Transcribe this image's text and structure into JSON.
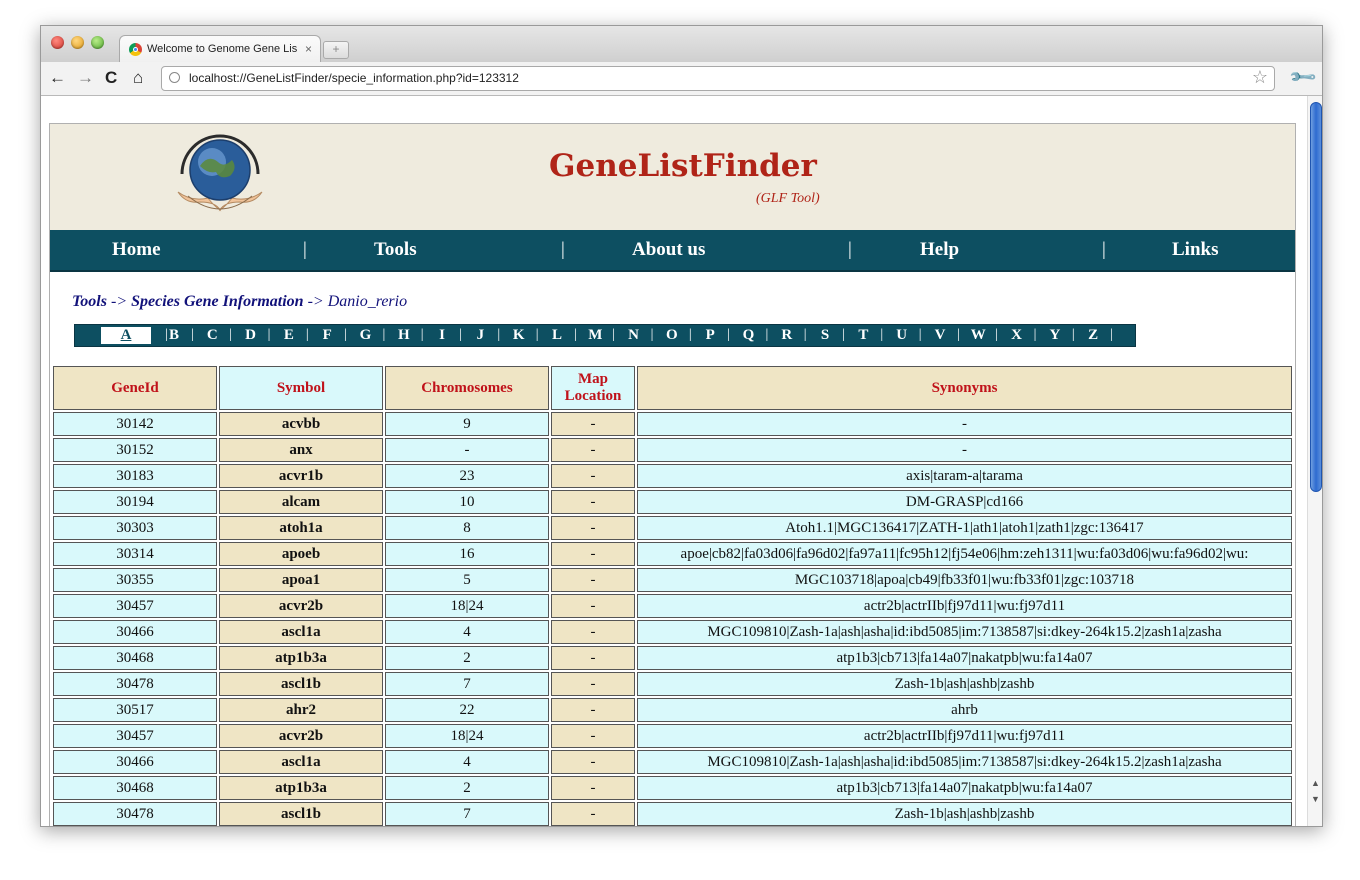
{
  "browser": {
    "tab_title": "Welcome to Genome Gene List Fi",
    "tab_close": "×",
    "new_tab": "+",
    "url": "localhost://GeneListFinder/specie_information.php?id=123312"
  },
  "header": {
    "title": "GeneListFinder",
    "subtitle": "(GLF Tool)"
  },
  "nav": {
    "items": [
      "Home",
      "Tools",
      "About us",
      "Help",
      "Links"
    ],
    "separator": "|"
  },
  "breadcrumb": {
    "part1": "Tools",
    "arrow": "->",
    "part2": "Species Gene Information",
    "part3": "Danio_rerio"
  },
  "alphabet": {
    "letters": [
      "A",
      "B",
      "C",
      "D",
      "E",
      "F",
      "G",
      "H",
      "I",
      "J",
      "K",
      "L",
      "M",
      "N",
      "O",
      "P",
      "Q",
      "R",
      "S",
      "T",
      "U",
      "V",
      "W",
      "X",
      "Y",
      "Z"
    ],
    "active": "A",
    "separator": "|"
  },
  "table": {
    "headers": [
      "GeneId",
      "Symbol",
      "Chromosomes",
      "Map Location",
      "Synonyms"
    ],
    "rows": [
      [
        "30142",
        "acvbb",
        "9",
        "-",
        "-"
      ],
      [
        "30152",
        "anx",
        "-",
        "-",
        "-"
      ],
      [
        "30183",
        "acvr1b",
        "23",
        "-",
        "axis|taram-a|tarama"
      ],
      [
        "30194",
        "alcam",
        "10",
        "-",
        "DM-GRASP|cd166"
      ],
      [
        "30303",
        "atoh1a",
        "8",
        "-",
        "Atoh1.1|MGC136417|ZATH-1|ath1|atoh1|zath1|zgc:136417"
      ],
      [
        "30314",
        "apoeb",
        "16",
        "-",
        "apoe|cb82|fa03d06|fa96d02|fa97a11|fc95h12|fj54e06|hm:zeh1311|wu:fa03d06|wu:fa96d02|wu:"
      ],
      [
        "30355",
        "apoa1",
        "5",
        "-",
        "MGC103718|apoa|cb49|fb33f01|wu:fb33f01|zgc:103718"
      ],
      [
        "30457",
        "acvr2b",
        "18|24",
        "-",
        "actr2b|actrIIb|fj97d11|wu:fj97d11"
      ],
      [
        "30466",
        "ascl1a",
        "4",
        "-",
        "MGC109810|Zash-1a|ash|asha|id:ibd5085|im:7138587|si:dkey-264k15.2|zash1a|zasha"
      ],
      [
        "30468",
        "atp1b3a",
        "2",
        "-",
        "atp1b3|cb713|fa14a07|nakatpb|wu:fa14a07"
      ],
      [
        "30478",
        "ascl1b",
        "7",
        "-",
        "Zash-1b|ash|ashb|zashb"
      ],
      [
        "30517",
        "ahr2",
        "22",
        "-",
        "ahrb"
      ],
      [
        "30457",
        "acvr2b",
        "18|24",
        "-",
        "actr2b|actrIIb|fj97d11|wu:fj97d11"
      ],
      [
        "30466",
        "ascl1a",
        "4",
        "-",
        "MGC109810|Zash-1a|ash|asha|id:ibd5085|im:7138587|si:dkey-264k15.2|zash1a|zasha"
      ],
      [
        "30468",
        "atp1b3a",
        "2",
        "-",
        "atp1b3|cb713|fa14a07|nakatpb|wu:fa14a07"
      ],
      [
        "30478",
        "ascl1b",
        "7",
        "-",
        "Zash-1b|ash|ashb|zashb"
      ]
    ]
  },
  "icons": {
    "back": "back-arrow-icon",
    "forward": "forward-arrow-icon",
    "reload": "reload-icon",
    "home": "home-icon",
    "bookmark": "star-icon",
    "settings": "wrench-icon",
    "logo": "globe-hands-logo"
  },
  "colors": {
    "nav_bg": "#0d4f61",
    "header_bg": "#efebde",
    "title_red": "#b02418",
    "cell_tan": "#efe5c5",
    "cell_cyan": "#d9f9fb",
    "symbol_blue": "#1a32c8"
  }
}
